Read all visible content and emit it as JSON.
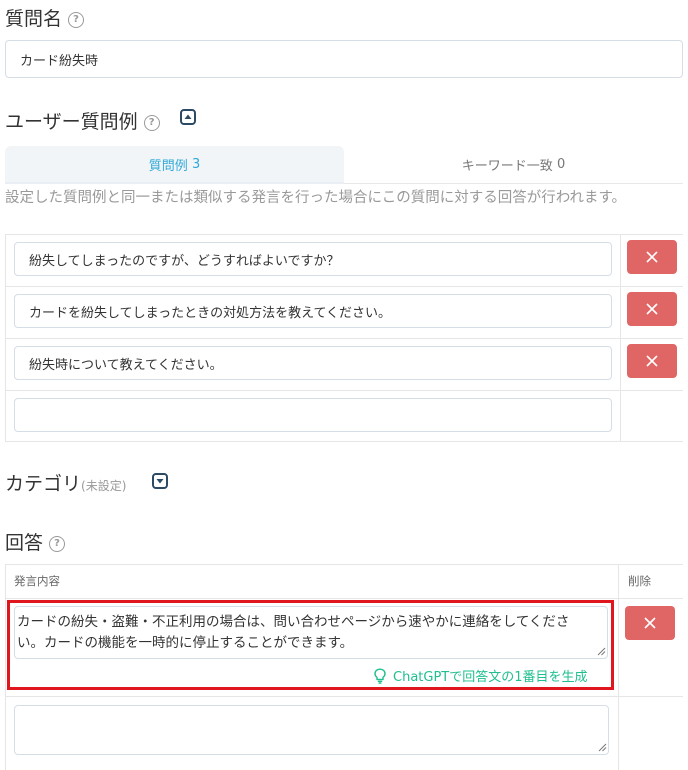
{
  "question_name": {
    "label": "質問名",
    "value": "カード紛失時"
  },
  "user_questions": {
    "label": "ユーザー質問例",
    "tabs": [
      {
        "label": "質問例",
        "count": "3",
        "active": true
      },
      {
        "label": "キーワード一致",
        "count": "0",
        "active": false
      }
    ],
    "description": "設定した質問例と同一または類似する発言を行った場合にこの質問に対する回答が行われます。",
    "examples": [
      "紛失してしまったのですが、どうすればよいですか？",
      "カードを紛失してしまったときの対処方法を教えてください。",
      "紛失時について教えてください。",
      ""
    ]
  },
  "category": {
    "label": "カテゴリ",
    "note": "(未設定)"
  },
  "answer": {
    "label": "回答",
    "col_content": "発言内容",
    "col_delete": "削除",
    "rows": [
      "カードの紛失・盗難・不正利用の場合は、問い合わせページから速やかに連絡をしてください。カードの機能を一時的に停止することができます。",
      ""
    ],
    "generate_link": "ChatGPTで回答文の1番目を生成"
  },
  "colors": {
    "accent": "#2fa9d8",
    "delete": "#e06666",
    "highlight": "#e0161e",
    "generate": "#1fbf8f",
    "toggle": "#2c4a63"
  },
  "icons": {
    "help": "question-circle-icon",
    "collapse": "caret-up-square-icon",
    "expand": "caret-down-square-icon",
    "delete": "x-icon",
    "generate": "lightbulb-icon"
  }
}
